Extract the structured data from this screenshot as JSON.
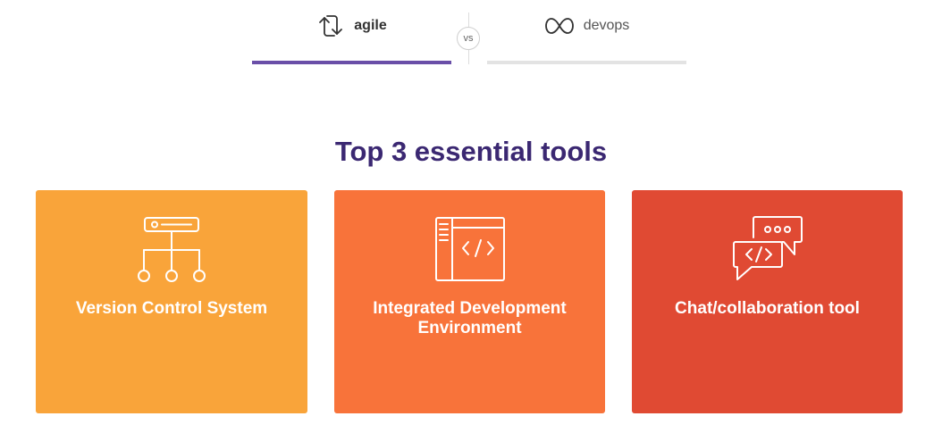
{
  "tabs": {
    "agile": {
      "label": "agile",
      "icon": "sync-arrows-icon",
      "active": true
    },
    "vs": "vs",
    "devops": {
      "label": "devops",
      "icon": "infinity-icon",
      "active": false
    }
  },
  "section": {
    "title": "Top 3 essential tools"
  },
  "cards": [
    {
      "label": "Version Control System",
      "icon": "version-control-tree-icon",
      "color": "#f9a43a"
    },
    {
      "label": "Integrated Development Environment",
      "icon": "code-editor-icon",
      "color": "#f8733a"
    },
    {
      "label": "Chat/collaboration tool",
      "icon": "chat-code-bubbles-icon",
      "color": "#e04a33"
    }
  ],
  "colors": {
    "accent": "#6a4fa8",
    "title": "#3b2872",
    "inactive_tab_underline": "#e3e3e3"
  }
}
